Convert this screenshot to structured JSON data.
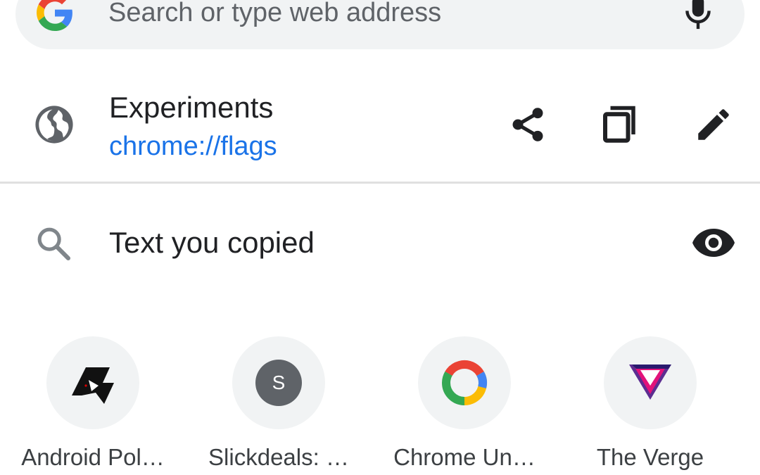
{
  "omnibox": {
    "placeholder": "Search or type web address",
    "logo_icon": "google-g-icon",
    "mic_icon": "mic-icon"
  },
  "current_page": {
    "title": "Experiments",
    "url": "chrome://flags",
    "icon": "globe-icon",
    "actions": [
      "share-icon",
      "copy-icon",
      "edit-icon"
    ]
  },
  "clipboard_suggestion": {
    "text": "Text you copied",
    "icon": "search-icon",
    "reveal_icon": "eye-icon"
  },
  "shortcuts": [
    {
      "label": "Android Pol…",
      "icon": "android-police-icon"
    },
    {
      "label": "Slickdeals: …",
      "icon": "letter-s-icon",
      "letter": "S"
    },
    {
      "label": "Chrome Un…",
      "icon": "chrome-ring-icon"
    },
    {
      "label": "The Verge",
      "icon": "verge-icon"
    }
  ],
  "colors": {
    "link": "#1a73e8",
    "surface": "#f1f3f4",
    "icon": "#5f6368"
  }
}
